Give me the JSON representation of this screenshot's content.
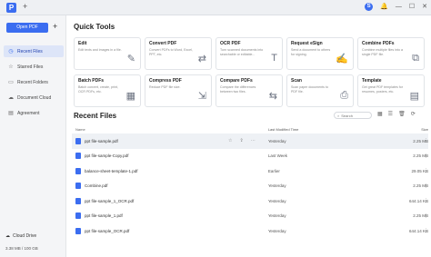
{
  "titlebar": {
    "app_logo": "P",
    "tab_plus": "+",
    "avatar_letter": "S",
    "icons": [
      "bell-icon",
      "minimize-icon",
      "maximize-icon",
      "close-icon"
    ],
    "icon_glyphs": [
      "🔔",
      "—",
      "☐",
      "✕"
    ]
  },
  "sidebar": {
    "open_button": "Open PDF",
    "plus": "+",
    "items": [
      {
        "label": "Recent Files",
        "icon": "◷",
        "active": true
      },
      {
        "label": "Starred Files",
        "icon": "☆",
        "active": false
      },
      {
        "label": "Recent Folders",
        "icon": "▭",
        "active": false
      },
      {
        "label": "Document Cloud",
        "icon": "☁",
        "active": false
      },
      {
        "label": "Agreement",
        "icon": "▤",
        "active": false
      }
    ],
    "cloud_label": "Cloud Drive",
    "storage": "3.38 MB / 100 GB"
  },
  "quick_tools": {
    "title": "Quick Tools",
    "cards": [
      {
        "title": "Edit",
        "desc": "Edit texts and images in a file.",
        "icon": "✎"
      },
      {
        "title": "Convert PDF",
        "desc": "Convert PDFs to Word, Excel, PPT, etc.",
        "icon": "⇄"
      },
      {
        "title": "OCR PDF",
        "desc": "Turn scanned documents into searchable or editable...",
        "icon": "T"
      },
      {
        "title": "Request eSign",
        "desc": "Send a document to others for signing.",
        "icon": "✍"
      },
      {
        "title": "Combine PDFs",
        "desc": "Combine multiple files into a single PDF file.",
        "icon": "⧉"
      },
      {
        "title": "Batch PDFs",
        "desc": "Batch convert, create, print, OCR PDFs, etc.",
        "icon": "▦"
      },
      {
        "title": "Compress PDF",
        "desc": "Reduce PDF file size.",
        "icon": "⇲"
      },
      {
        "title": "Compare PDFs",
        "desc": "Compare the differences between two files.",
        "icon": "⇆"
      },
      {
        "title": "Scan",
        "desc": "Scan paper documents to PDF file.",
        "icon": "⎙"
      },
      {
        "title": "Template",
        "desc": "Get great PDF templates for resumes, posters, etc.",
        "icon": "▤"
      }
    ]
  },
  "recent_files": {
    "title": "Recent Files",
    "search_placeholder": "Search",
    "view_icons": [
      "▦",
      "☰",
      "🗑",
      "⟳"
    ],
    "columns": {
      "name": "Name",
      "date": "Last Modified Time",
      "size": "Size"
    },
    "row_actions": [
      "☆",
      "⇪",
      "⋯"
    ],
    "more": "⋮",
    "rows": [
      {
        "name": "ppt file-sample.pdf",
        "date": "Yesterday",
        "size": "2.25 MB"
      },
      {
        "name": "ppt file-sample-Copy.pdf",
        "date": "Last Week",
        "size": "2.25 MB"
      },
      {
        "name": "balance-sheet-template-1.pdf",
        "date": "Earlier",
        "size": "29.05 KB"
      },
      {
        "name": "Combine.pdf",
        "date": "Yesterday",
        "size": "2.25 MB"
      },
      {
        "name": "ppt file-sample_1_OCR.pdf",
        "date": "Yesterday",
        "size": "644.14 KB"
      },
      {
        "name": "ppt file-sample_1.pdf",
        "date": "Yesterday",
        "size": "2.25 MB"
      },
      {
        "name": "ppt file-sample_OCR.pdf",
        "date": "Yesterday",
        "size": "644.14 KB"
      }
    ]
  }
}
